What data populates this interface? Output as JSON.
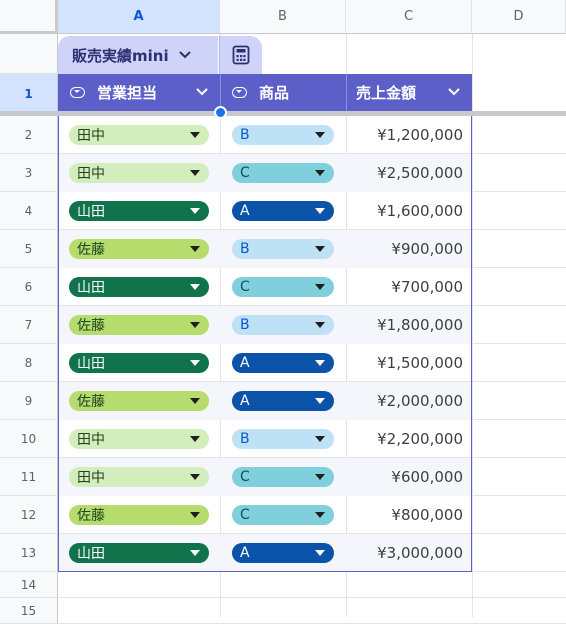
{
  "columns": [
    "A",
    "B",
    "C",
    "D"
  ],
  "table": {
    "name": "販売実績mini",
    "headers": [
      "営業担当",
      "商品",
      "売上金額"
    ],
    "rows": [
      {
        "row": "2",
        "rep": "田中",
        "rep_style": "light",
        "product": "B",
        "product_style": "light",
        "amount": "¥1,200,000"
      },
      {
        "row": "3",
        "rep": "田中",
        "rep_style": "light",
        "product": "C",
        "product_style": "mid",
        "amount": "¥2,500,000"
      },
      {
        "row": "4",
        "rep": "山田",
        "rep_style": "dark",
        "product": "A",
        "product_style": "dark",
        "amount": "¥1,600,000"
      },
      {
        "row": "5",
        "rep": "佐藤",
        "rep_style": "mid",
        "product": "B",
        "product_style": "light",
        "amount": "¥900,000"
      },
      {
        "row": "6",
        "rep": "山田",
        "rep_style": "dark",
        "product": "C",
        "product_style": "mid",
        "amount": "¥700,000"
      },
      {
        "row": "7",
        "rep": "佐藤",
        "rep_style": "mid",
        "product": "B",
        "product_style": "light",
        "amount": "¥1,800,000"
      },
      {
        "row": "8",
        "rep": "山田",
        "rep_style": "dark",
        "product": "A",
        "product_style": "dark",
        "amount": "¥1,500,000"
      },
      {
        "row": "9",
        "rep": "佐藤",
        "rep_style": "mid",
        "product": "A",
        "product_style": "dark",
        "amount": "¥2,000,000"
      },
      {
        "row": "10",
        "rep": "田中",
        "rep_style": "light",
        "product": "B",
        "product_style": "light",
        "amount": "¥2,200,000"
      },
      {
        "row": "11",
        "rep": "田中",
        "rep_style": "light",
        "product": "C",
        "product_style": "mid",
        "amount": "¥600,000"
      },
      {
        "row": "12",
        "rep": "佐藤",
        "rep_style": "mid",
        "product": "C",
        "product_style": "mid",
        "amount": "¥800,000"
      },
      {
        "row": "13",
        "rep": "山田",
        "rep_style": "dark",
        "product": "A",
        "product_style": "dark",
        "amount": "¥3,000,000"
      }
    ]
  },
  "extra_rows": [
    "14",
    "15"
  ],
  "header_row_number": "1",
  "colors": {
    "table_header": "#5b5fc7",
    "tab_bg": "#cfd3f7",
    "rep_light": "#d4edbc",
    "rep_mid": "#b5dc6c",
    "rep_dark": "#11734b",
    "prod_light": "#bfe1f6",
    "prod_mid": "#7fd0dc",
    "prod_dark": "#0a53a8"
  },
  "icons": {
    "dropdown_column": "dropdown-column-icon",
    "calculator": "calculator-icon",
    "chevron": "chevron-down-icon",
    "chip_arrow": "triangle-down-icon"
  }
}
